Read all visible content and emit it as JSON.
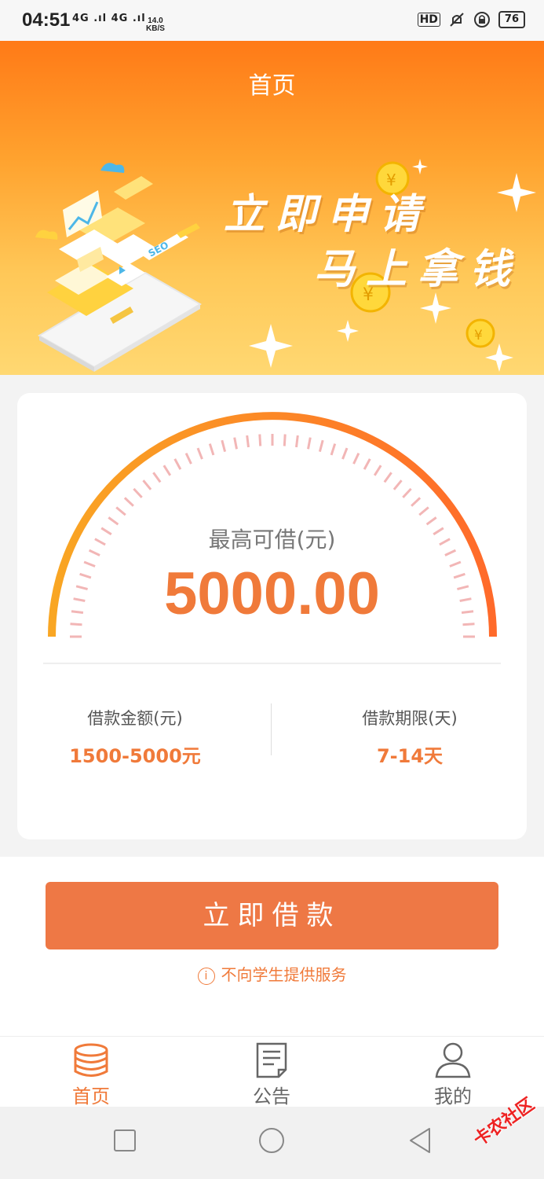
{
  "status_bar": {
    "time": "04:51",
    "signal_text": "4G .ıl 4G .ıl",
    "speed_value": "14.0",
    "speed_unit": "KB/S",
    "hd_label": "HD",
    "battery": "76",
    "icons": [
      "signal-icon",
      "wifi-icon",
      "hd-icon",
      "mute-icon",
      "lock-rotation-icon",
      "battery-icon"
    ]
  },
  "header": {
    "title": "首页"
  },
  "hero": {
    "slogan_line1": "立即申请",
    "slogan_line2": "马上拿钱",
    "illustration_label": "SEO"
  },
  "gauge": {
    "label": "最高可借(元)",
    "value": "5000.00"
  },
  "stats": {
    "amount_label": "借款金额(元)",
    "amount_value": "1500-5000元",
    "term_label": "借款期限(天)",
    "term_value": "7-14天"
  },
  "actions": {
    "apply_label": "立即借款",
    "notice": "不向学生提供服务"
  },
  "tabs": [
    {
      "label": "首页",
      "icon": "coins-stack-icon",
      "active": true
    },
    {
      "label": "公告",
      "icon": "document-icon",
      "active": false
    },
    {
      "label": "我的",
      "icon": "user-icon",
      "active": false
    }
  ],
  "watermark": "卡农社区",
  "colors": {
    "accent": "#f07a3a",
    "button": "#ee7845",
    "hero_top": "#ff7a17",
    "hero_bottom": "#ffd872",
    "tick": "#f2b6b6"
  }
}
